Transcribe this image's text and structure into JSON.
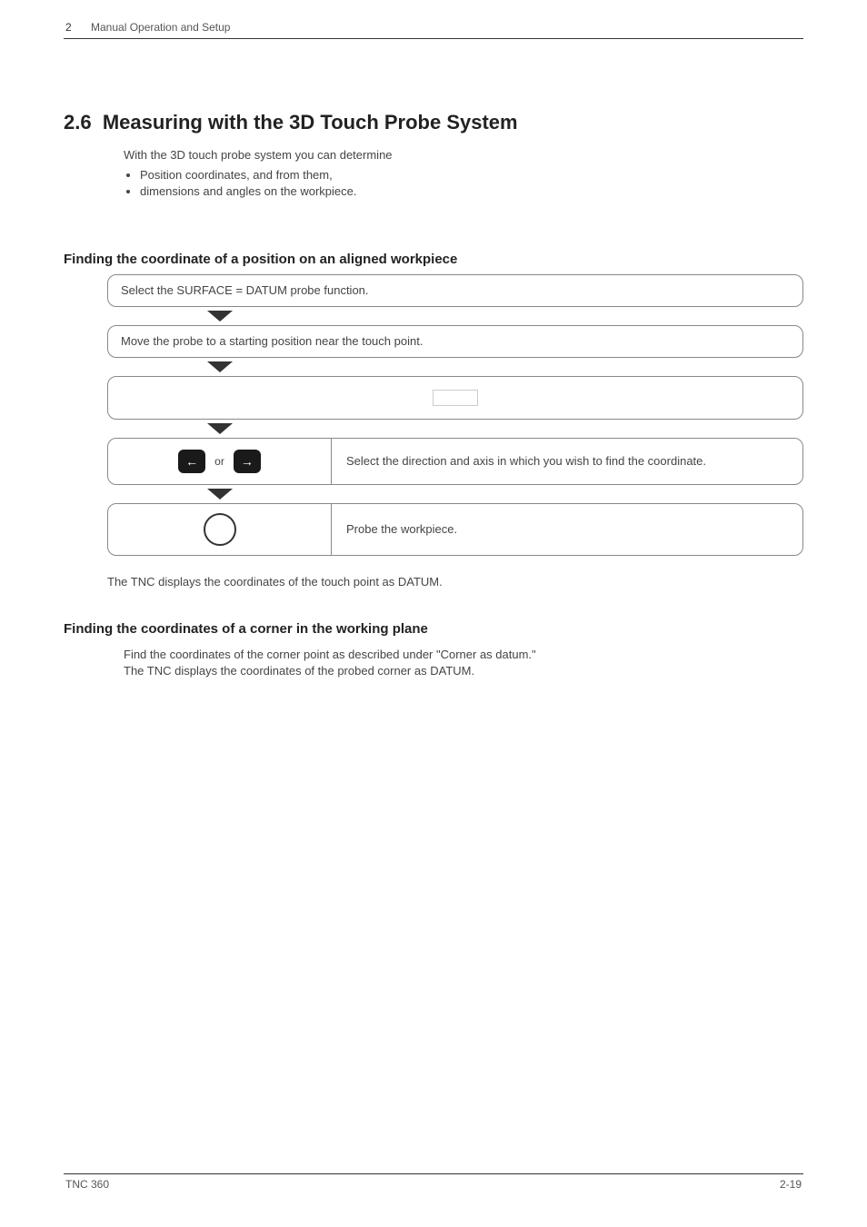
{
  "header": {
    "chapter_num": "2",
    "chapter_title": "Manual Operation and Setup"
  },
  "section": {
    "number": "2.6",
    "title": "Measuring with the 3D Touch Probe System"
  },
  "intro": {
    "lead": "With the 3D touch probe system you can determine",
    "bullets": [
      "Position coordinates, and from them,",
      "dimensions and angles on the workpiece."
    ]
  },
  "subheading1": "Finding the coordinate of a position on an aligned workpiece",
  "flow": {
    "step1": "Select the SURFACE = DATUM probe function.",
    "step2": "Move the probe to a starting position near the touch point.",
    "step4_desc": "Select the direction and axis in which you wish to find the coordinate.",
    "step4_or": "or",
    "step5_desc": "Probe the workpiece."
  },
  "after_flow": "The TNC displays the coordinates of the touch point as DATUM.",
  "subheading2": "Finding the coordinates of a corner in the working plane",
  "para2": "Find the coordinates of the corner point as described under \"Corner as datum.\" The TNC displays the coordinates of the probed corner as DATUM.",
  "footer": {
    "left": "TNC 360",
    "right": "2-19"
  }
}
